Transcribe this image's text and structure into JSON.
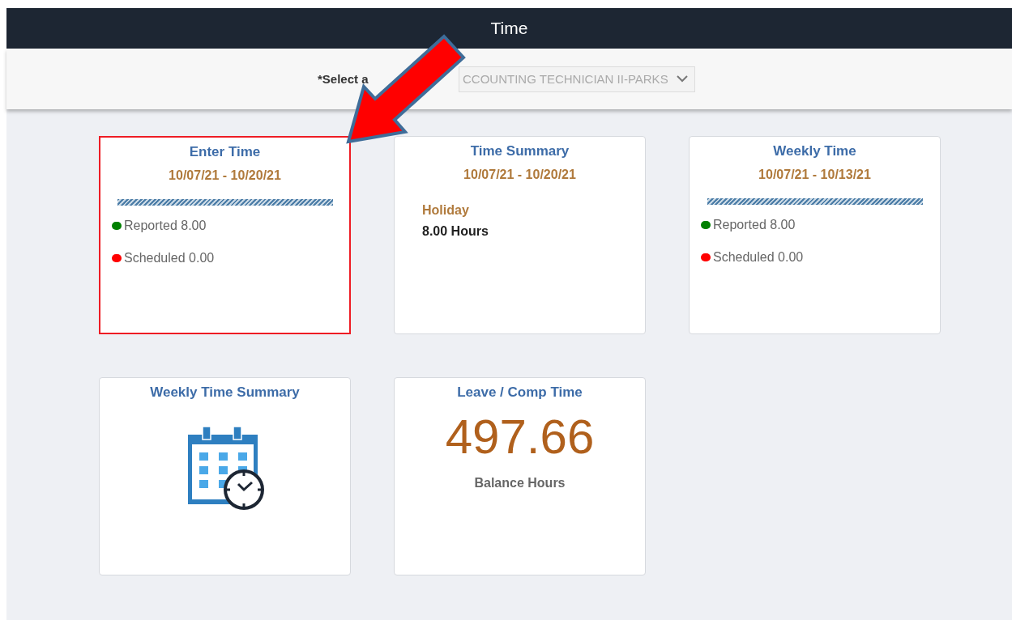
{
  "header": {
    "title": "Time"
  },
  "job_select": {
    "label": "*Select a",
    "value": "CCOUNTING TECHNICIAN II-PARKS"
  },
  "tiles": [
    {
      "kind": "progress",
      "title": "Enter Time",
      "highlighted": true,
      "dates": "10/07/21 - 10/20/21",
      "legend": [
        {
          "label": "Reported 8.00",
          "color": "#008000"
        },
        {
          "label": "Scheduled 0.00",
          "color": "#ff0000"
        }
      ]
    },
    {
      "kind": "summary",
      "title": "Time Summary",
      "highlighted": false,
      "dates": "10/07/21 - 10/20/21",
      "category": "Holiday",
      "hours": "8.00 Hours"
    },
    {
      "kind": "progress",
      "title": "Weekly Time",
      "highlighted": false,
      "dates": "10/07/21 - 10/13/21",
      "legend": [
        {
          "label": "Reported 8.00",
          "color": "#008000"
        },
        {
          "label": "Scheduled 0.00",
          "color": "#ff0000"
        }
      ]
    },
    {
      "kind": "icon",
      "title": "Weekly Time Summary",
      "highlighted": false
    },
    {
      "kind": "balance",
      "title": "Leave / Comp Time",
      "highlighted": false,
      "value": "497.66",
      "caption": "Balance Hours"
    }
  ]
}
